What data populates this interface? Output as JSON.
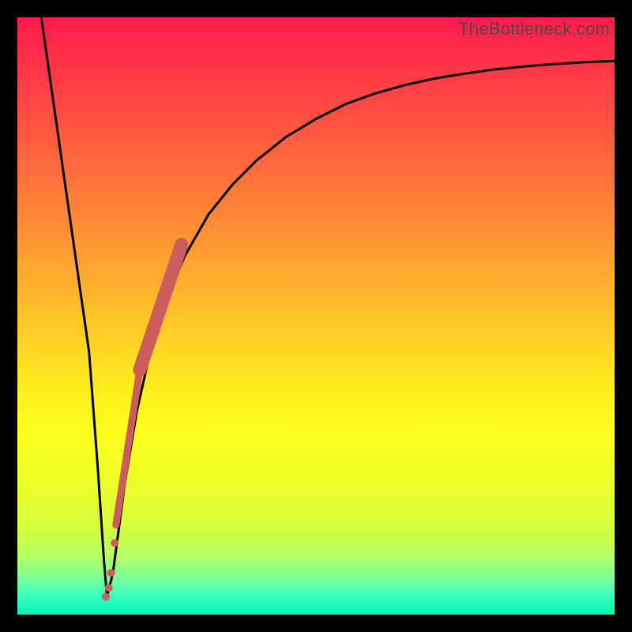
{
  "watermark": "TheBottleneck.com",
  "colors": {
    "frame": "#000000",
    "curve": "#000000",
    "highlight": "#cd5c5c"
  },
  "chart_data": {
    "type": "line",
    "title": "",
    "xlabel": "",
    "ylabel": "",
    "xlim": [
      0,
      100
    ],
    "ylim": [
      0,
      100
    ],
    "grid": false,
    "series": [
      {
        "name": "bottleneck-curve",
        "x": [
          4,
          6,
          8,
          10,
          12,
          13.5,
          14.5,
          15,
          16,
          18,
          20,
          22,
          25,
          28,
          32,
          36,
          40,
          45,
          50,
          55,
          60,
          65,
          70,
          75,
          80,
          85,
          90,
          95,
          100
        ],
        "values": [
          100,
          86,
          72,
          58,
          44,
          24,
          9,
          3,
          7,
          22,
          34,
          43,
          53,
          60,
          67,
          72,
          76,
          80,
          83,
          85.5,
          87.3,
          88.7,
          89.8,
          90.6,
          91.3,
          91.8,
          92.2,
          92.5,
          92.7
        ]
      },
      {
        "name": "highlight-band-thick",
        "x": [
          20.5,
          27.5
        ],
        "values": [
          41,
          62
        ]
      },
      {
        "name": "highlight-band-thin",
        "x": [
          16.5,
          20.5
        ],
        "values": [
          15,
          41
        ]
      },
      {
        "name": "highlight-dot-cluster",
        "x": [
          14.8,
          15.3,
          15.7,
          16.3
        ],
        "values": [
          3,
          4.5,
          7,
          12
        ]
      }
    ]
  }
}
